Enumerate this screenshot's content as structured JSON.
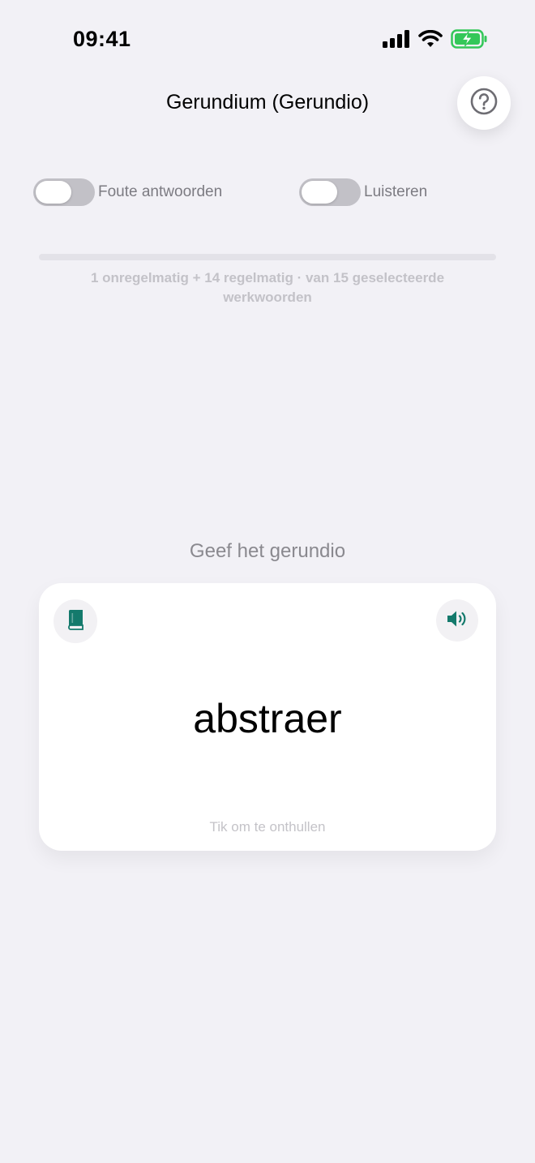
{
  "status_bar": {
    "time": "09:41"
  },
  "header": {
    "title": "Gerundium (Gerundio)",
    "help_icon": "question-circle-icon"
  },
  "toggles": [
    {
      "label": "Foute antwoorden",
      "on": false
    },
    {
      "label": "Luisteren",
      "on": false
    }
  ],
  "progress": {
    "value": 0,
    "text": "1 onregelmatig + 14 regelmatig · van 15 geselecteerde werkwoorden"
  },
  "prompt": "Geef het gerundio",
  "card": {
    "word": "abstraer",
    "hint": "Tik om te onthullen",
    "book_icon": "book-icon",
    "speaker_icon": "speaker-icon",
    "accent_color": "#147a6c"
  },
  "colors": {
    "background": "#f2f1f6",
    "card": "#ffffff",
    "battery_green": "#34c759"
  }
}
